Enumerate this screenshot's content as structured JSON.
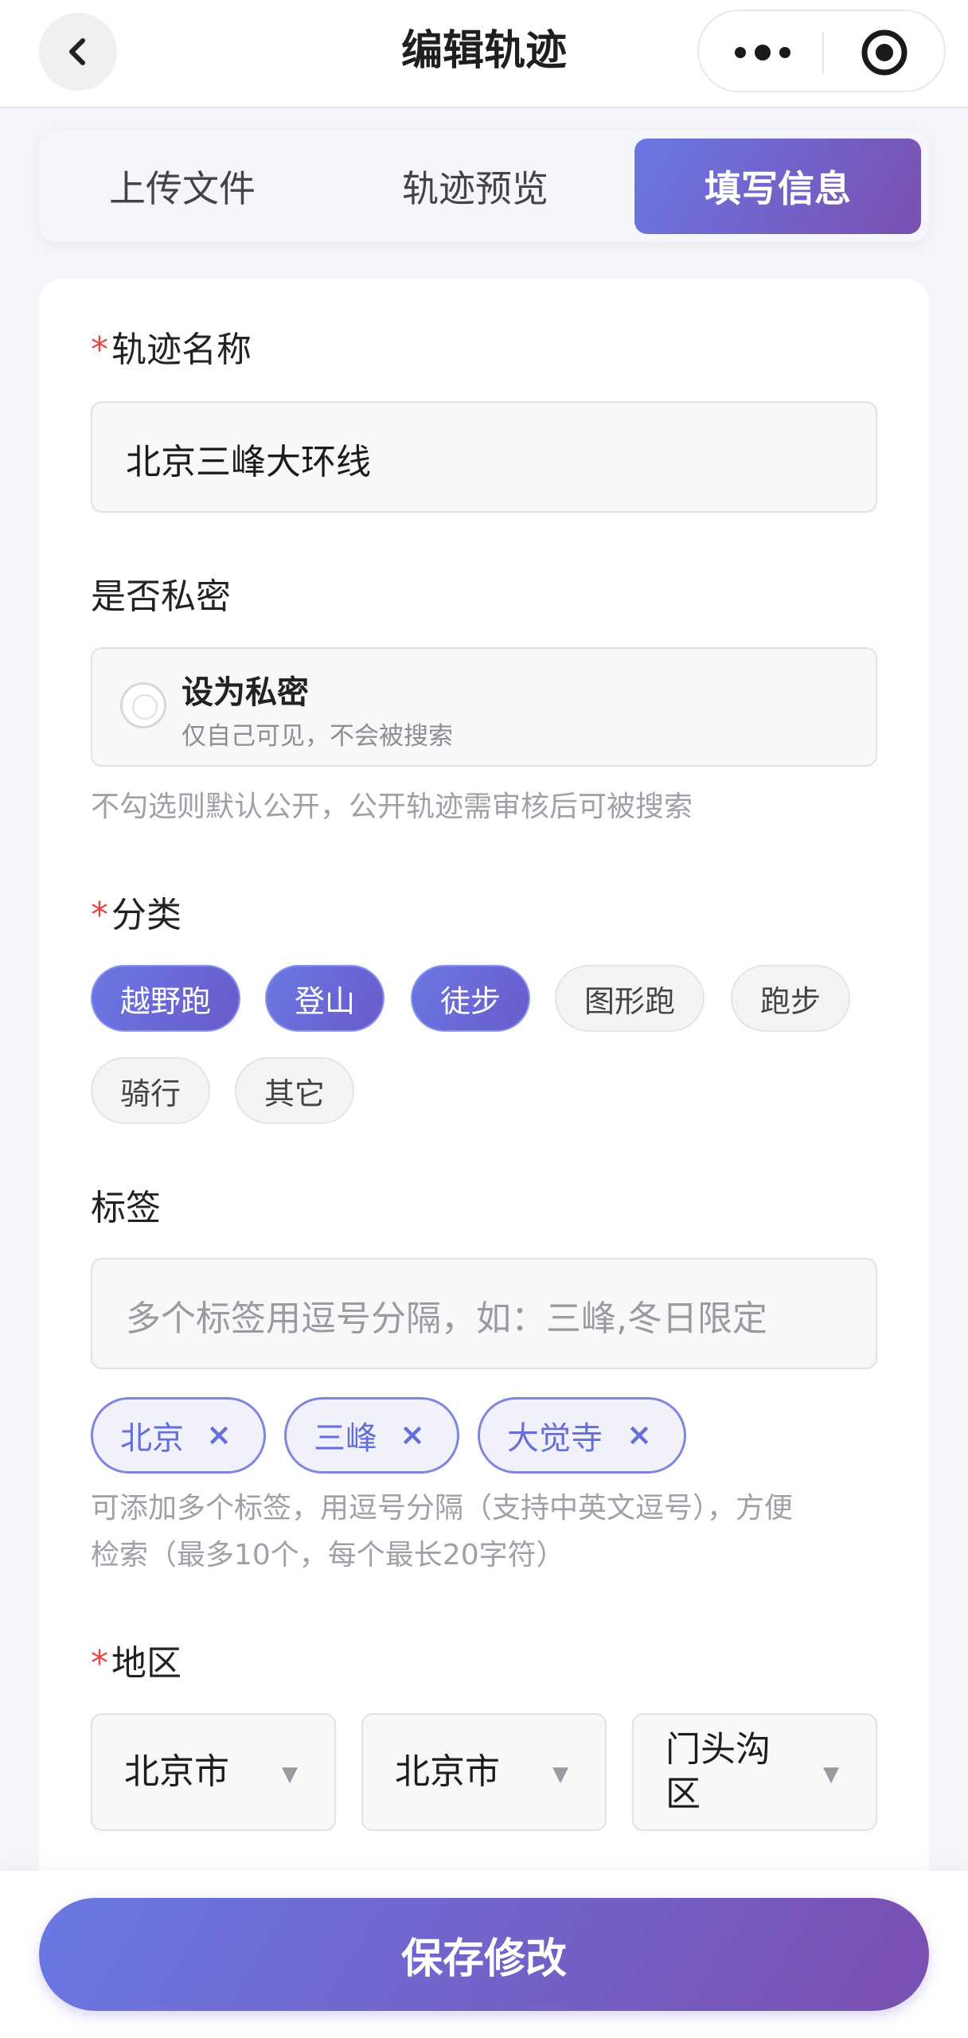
{
  "navbar": {
    "title": "编辑轨迹",
    "back_icon": "chevron-left-icon",
    "more_icon": "more-dots-icon",
    "target_icon": "record-target-icon"
  },
  "steps": [
    {
      "label": "上传文件",
      "active": false
    },
    {
      "label": "轨迹预览",
      "active": false
    },
    {
      "label": "填写信息",
      "active": true
    }
  ],
  "form": {
    "name": {
      "required_mark": "*",
      "label": "轨迹名称",
      "value": "北京三峰大环线"
    },
    "privacy": {
      "label": "是否私密",
      "option_title": "设为私密",
      "option_desc": "仅自己可见，不会被搜索",
      "checked": false,
      "hint": "不勾选则默认公开，公开轨迹需审核后可被搜索"
    },
    "category": {
      "required_mark": "*",
      "label": "分类",
      "options": [
        {
          "label": "越野跑",
          "selected": true
        },
        {
          "label": "登山",
          "selected": true
        },
        {
          "label": "徒步",
          "selected": true
        },
        {
          "label": "图形跑",
          "selected": false
        },
        {
          "label": "跑步",
          "selected": false
        },
        {
          "label": "骑行",
          "selected": false
        },
        {
          "label": "其它",
          "selected": false
        }
      ]
    },
    "tags": {
      "label": "标签",
      "placeholder": "多个标签用逗号分隔，如：三峰,冬日限定",
      "items": [
        "北京",
        "三峰",
        "大觉寺"
      ],
      "remove_symbol": "×",
      "hint_line1": "可添加多个标签，用逗号分隔（支持中英文逗号），方便",
      "hint_line2": "检索（最多10个，每个最长20字符）"
    },
    "region": {
      "required_mark": "*",
      "label": "地区",
      "province": "北京市",
      "city": "北京市",
      "district_line1": "门头沟",
      "district_line2": "区",
      "arrow": "▼"
    }
  },
  "footer": {
    "save_label": "保存修改"
  },
  "colors": {
    "accent_start": "#6a78e3",
    "accent_end": "#7a4fb0",
    "required": "#e54545"
  }
}
